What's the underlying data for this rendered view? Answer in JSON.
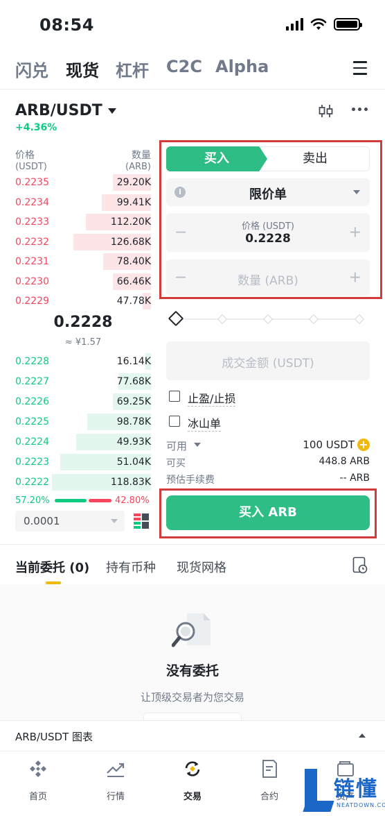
{
  "status_bar": {
    "time": "08:54"
  },
  "top_nav": {
    "tabs": [
      "闪兑",
      "现货",
      "杠杆",
      "C2C",
      "Alpha"
    ],
    "active": 1
  },
  "pair": {
    "symbol": "ARB/USDT",
    "change": "+4.36%"
  },
  "order_book": {
    "price_header": "价格",
    "price_unit": "(USDT)",
    "qty_header": "数量",
    "qty_unit": "(ARB)",
    "asks": [
      {
        "price": "0.2235",
        "qty": "29.20K",
        "depth": 0.28
      },
      {
        "price": "0.2234",
        "qty": "99.41K",
        "depth": 0.36
      },
      {
        "price": "0.2233",
        "qty": "112.20K",
        "depth": 0.48
      },
      {
        "price": "0.2232",
        "qty": "126.68K",
        "depth": 0.57
      },
      {
        "price": "0.2231",
        "qty": "78.40K",
        "depth": 0.35
      },
      {
        "price": "0.2230",
        "qty": "66.46K",
        "depth": 0.28
      },
      {
        "price": "0.2229",
        "qty": "47.78K",
        "depth": 0.06
      }
    ],
    "mid_price": "0.2228",
    "mid_fiat": "≈ ¥1.57",
    "bids": [
      {
        "price": "0.2228",
        "qty": "16.14K",
        "depth": 0.04
      },
      {
        "price": "0.2227",
        "qty": "77.68K",
        "depth": 0.24
      },
      {
        "price": "0.2226",
        "qty": "69.25K",
        "depth": 0.28
      },
      {
        "price": "0.2225",
        "qty": "98.78K",
        "depth": 0.47
      },
      {
        "price": "0.2224",
        "qty": "49.93K",
        "depth": 0.55
      },
      {
        "price": "0.2223",
        "qty": "51.04K",
        "depth": 0.67
      },
      {
        "price": "0.2222",
        "qty": "118.83K",
        "depth": 0.73
      }
    ],
    "buy_ratio": "57.20%",
    "sell_ratio": "42.80%",
    "precision": "0.0001"
  },
  "trade_form": {
    "buy_tab": "买入",
    "sell_tab": "卖出",
    "order_type": "限价单",
    "price_label": "价格 (USDT)",
    "price_value": "0.2228",
    "qty_placeholder": "数量 (ARB)",
    "total_placeholder": "成交金额 (USDT)",
    "tpsl_label": "止盈/止损",
    "iceberg_label": "冰山单",
    "available_label": "可用",
    "available_value": "100 USDT",
    "can_buy_label": "可买",
    "can_buy_value": "448.8 ARB",
    "fee_label": "预估手续费",
    "fee_value": "-- ARB",
    "submit_label": "买入 ARB"
  },
  "orders_section": {
    "tabs": [
      "当前委托 (0)",
      "持有币种",
      "现货网格"
    ],
    "empty_title": "没有委托",
    "empty_subtitle": "让顶级交易者为您交易"
  },
  "chart_bar": {
    "title": "ARB/USDT 图表"
  },
  "bottom_nav": {
    "items": [
      "首页",
      "行情",
      "交易",
      "合约",
      "资产"
    ],
    "active": 2
  },
  "watermark": {
    "text": "链懂",
    "sub": "NEATDOWN.COM"
  },
  "colors": {
    "buy": "#2ebd85",
    "sell": "#f6465d",
    "accent": "#f0b90b",
    "highlight": "#d43a3a"
  }
}
